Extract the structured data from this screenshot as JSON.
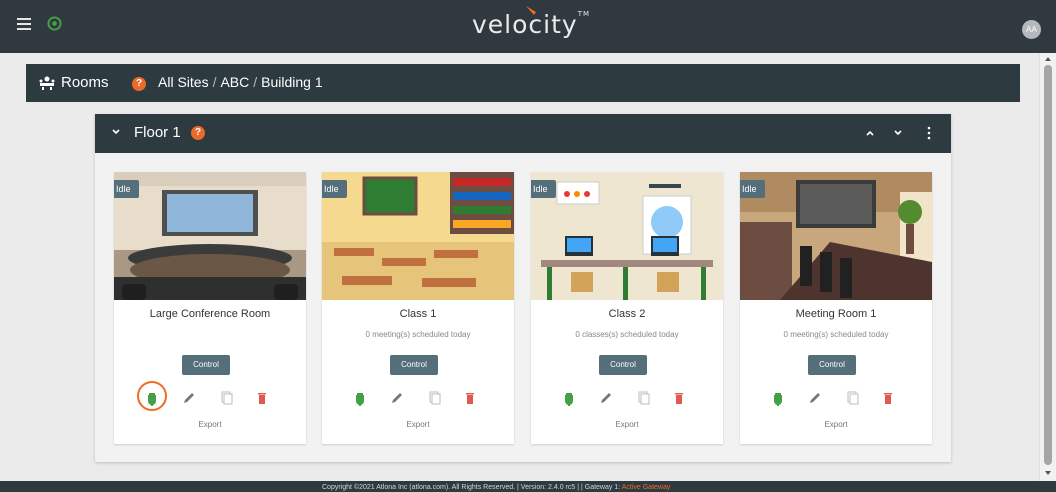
{
  "app": {
    "logo_text": "velocity",
    "tm": "TM",
    "user_initials": "AA"
  },
  "rooms_bar": {
    "title": "Rooms",
    "help": "?",
    "breadcrumb": [
      "All Sites",
      "ABC",
      "Building 1"
    ]
  },
  "floor": {
    "title": "Floor 1",
    "help": "?"
  },
  "rooms": [
    {
      "status": "Idle",
      "name": "Large Conference Room",
      "subtitle": "",
      "control_label": "Control",
      "export_label": "Export"
    },
    {
      "status": "Idle",
      "name": "Class 1",
      "subtitle": "0 meeting(s) scheduled today",
      "control_label": "Control",
      "export_label": "Export"
    },
    {
      "status": "Idle",
      "name": "Class 2",
      "subtitle": "0 classes(s) scheduled today",
      "control_label": "Control",
      "export_label": "Export"
    },
    {
      "status": "Idle",
      "name": "Meeting Room 1",
      "subtitle": "0 meeting(s) scheduled today",
      "control_label": "Control",
      "export_label": "Export"
    }
  ],
  "footer": {
    "text": "Copyright ©2021 Atlona Inc (atlona.com). All Rights Reserved. | Version: 2.4.0 rc5 | | Gateway 1: ",
    "gateway_status": "Active Gateway"
  },
  "colors": {
    "topbar": "#30393f",
    "panel_header": "#2d3a40",
    "accent_orange": "#ea6a2a",
    "power_green": "#43a047",
    "delete_red": "#e05a4f",
    "badge": "#546e7a"
  },
  "icons": [
    "hamburger-icon",
    "globe-icon",
    "rooms-icon",
    "chevron-down-icon",
    "chevron-up-icon",
    "more-vertical-icon",
    "power-icon",
    "pencil-icon",
    "copy-icon",
    "trash-icon"
  ]
}
